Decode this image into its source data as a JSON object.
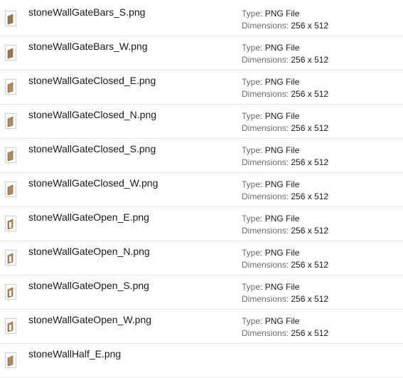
{
  "labels": {
    "type": "Type:",
    "dimensions": "Dimensions:"
  },
  "files": [
    {
      "name": "stoneWallGateBars_S.png",
      "type": "PNG File",
      "dimensions": "256 x 512",
      "icon": "gate-bars-thumbnail-icon"
    },
    {
      "name": "stoneWallGateBars_W.png",
      "type": "PNG File",
      "dimensions": "256 x 512",
      "icon": "gate-bars-thumbnail-icon"
    },
    {
      "name": "stoneWallGateClosed_E.png",
      "type": "PNG File",
      "dimensions": "256 x 512",
      "icon": "gate-closed-thumbnail-icon"
    },
    {
      "name": "stoneWallGateClosed_N.png",
      "type": "PNG File",
      "dimensions": "256 x 512",
      "icon": "gate-closed-thumbnail-icon"
    },
    {
      "name": "stoneWallGateClosed_S.png",
      "type": "PNG File",
      "dimensions": "256 x 512",
      "icon": "gate-closed-thumbnail-icon"
    },
    {
      "name": "stoneWallGateClosed_W.png",
      "type": "PNG File",
      "dimensions": "256 x 512",
      "icon": "gate-closed-thumbnail-icon"
    },
    {
      "name": "stoneWallGateOpen_E.png",
      "type": "PNG File",
      "dimensions": "256 x 512",
      "icon": "gate-open-thumbnail-icon"
    },
    {
      "name": "stoneWallGateOpen_N.png",
      "type": "PNG File",
      "dimensions": "256 x 512",
      "icon": "gate-open-thumbnail-icon"
    },
    {
      "name": "stoneWallGateOpen_S.png",
      "type": "PNG File",
      "dimensions": "256 x 512",
      "icon": "gate-open-thumbnail-icon"
    },
    {
      "name": "stoneWallGateOpen_W.png",
      "type": "PNG File",
      "dimensions": "256 x 512",
      "icon": "gate-open-thumbnail-icon"
    },
    {
      "name": "stoneWallHalf_E.png",
      "type": "",
      "dimensions": "",
      "icon": "wall-thumbnail-icon"
    }
  ],
  "colors": {
    "divider": "#e5e5e5",
    "stone": "#b08a5a",
    "stone_dark": "#6e5334"
  }
}
